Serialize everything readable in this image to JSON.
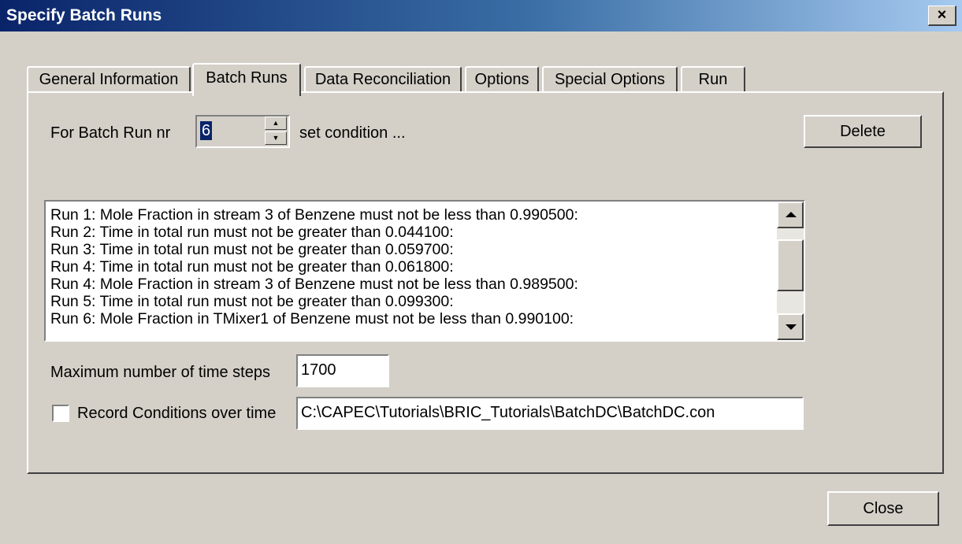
{
  "window": {
    "title": "Specify Batch Runs",
    "close_glyph": "×"
  },
  "tabs": [
    {
      "label": "General Information"
    },
    {
      "label": "Batch Runs"
    },
    {
      "label": "Data Reconciliation"
    },
    {
      "label": "Options"
    },
    {
      "label": "Special Options"
    },
    {
      "label": "Run"
    }
  ],
  "active_tab": "Batch Runs",
  "batch": {
    "for_label": "For Batch Run nr",
    "run_number": "6",
    "set_condition_label": "set condition ...",
    "delete_label": "Delete"
  },
  "conditions": [
    "Run 1: Mole Fraction in stream 3 of Benzene must not be less than 0.990500:",
    "Run 2: Time in total run must not be greater than 0.044100:",
    "Run 3: Time in total run must not be greater than 0.059700:",
    "Run 4: Time in total run must not be greater than 0.061800:",
    "Run 4: Mole Fraction in stream 3 of Benzene must not be less than 0.989500:",
    "Run 5: Time in total run must not be greater than 0.099300:",
    "Run 6: Mole Fraction in TMixer1 of Benzene must not be less than 0.990100:"
  ],
  "max_steps": {
    "label": "Maximum number of time steps",
    "value": "1700"
  },
  "record": {
    "label": "Record Conditions over time",
    "checked": false,
    "path": "C:\\CAPEC\\Tutorials\\BRIC_Tutorials\\BatchDC\\BatchDC.con"
  },
  "close_label": "Close",
  "icons": {
    "spin_up": "spin-up-icon",
    "spin_down": "spin-down-icon",
    "scroll_up": "scroll-up-icon",
    "scroll_down": "scroll-down-icon"
  }
}
